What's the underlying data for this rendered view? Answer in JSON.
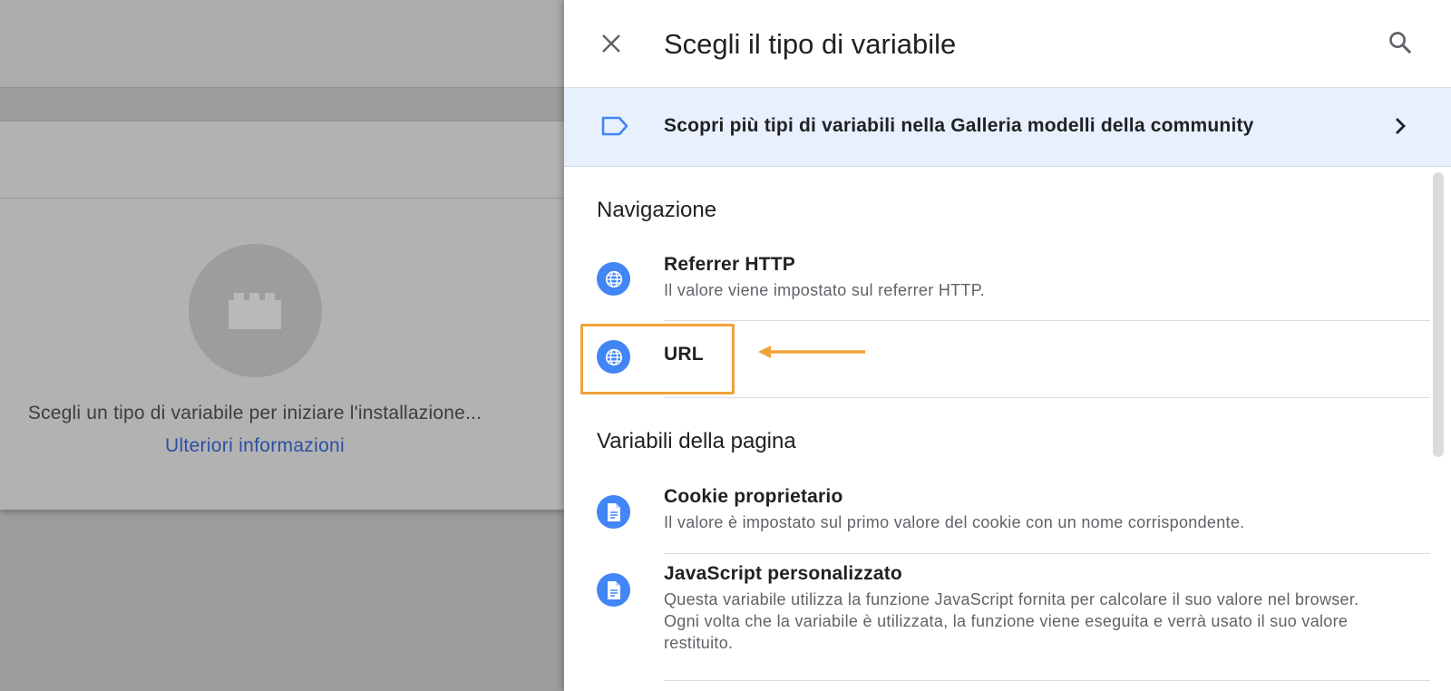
{
  "background": {
    "empty_message": "Scegli un tipo di variabile per iniziare l'installazione...",
    "learn_more_link": "Ulteriori informazioni",
    "empty_icon": "puzzle-block-icon"
  },
  "panel": {
    "title": "Scegli il tipo di variabile",
    "close_icon": "close-icon",
    "search_icon": "search-icon",
    "gallery_banner": {
      "label": "Scopri più tipi di variabili nella Galleria modelli della community",
      "icon": "tag-icon",
      "chevron": "chevron-right-icon"
    },
    "sections": [
      {
        "heading": "Navigazione",
        "items": [
          {
            "name": "Referrer HTTP",
            "description": "Il valore viene impostato sul referrer HTTP.",
            "icon": "globe-icon"
          },
          {
            "name": "URL",
            "description": "",
            "icon": "globe-icon",
            "highlighted": true
          }
        ]
      },
      {
        "heading": "Variabili della pagina",
        "items": [
          {
            "name": "Cookie proprietario",
            "description": "Il valore è impostato sul primo valore del cookie con un nome corrispondente.",
            "icon": "document-icon"
          },
          {
            "name": "JavaScript personalizzato",
            "description": "Questa variabile utilizza la funzione JavaScript fornita per calcolare il suo valore nel browser. Ogni volta che la variabile è utilizzata, la funzione viene eseguita e verrà usato il suo valore restituito.",
            "icon": "document-icon"
          }
        ]
      }
    ]
  },
  "colors": {
    "accent_blue": "#4285f4",
    "highlight_orange": "#f0a23b",
    "banner_bg": "#e8f0fe",
    "link_blue": "#2b4fa3"
  }
}
